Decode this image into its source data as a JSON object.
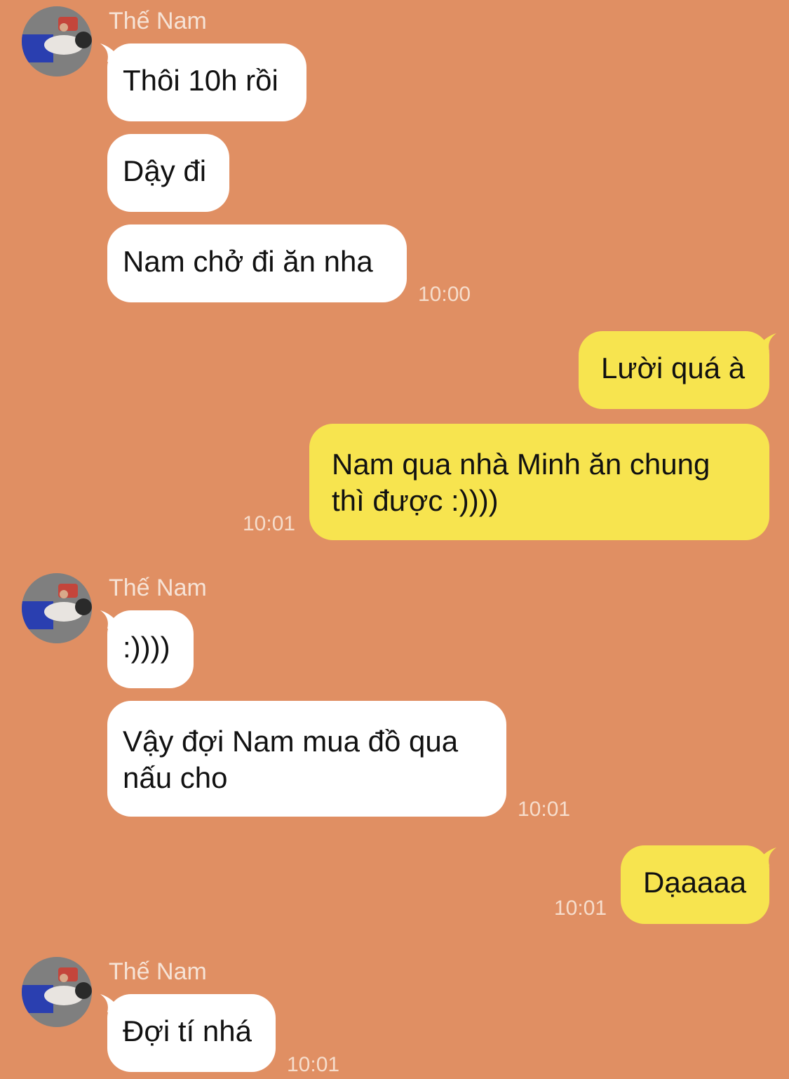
{
  "chat": {
    "contact_name": "Thế Nam",
    "messages": {
      "m1": {
        "text": "Thôi 10h rồi",
        "from": "Thế Nam"
      },
      "m2": {
        "text": "Dậy đi",
        "from": "Thế Nam"
      },
      "m3": {
        "text": "Nam chở đi ăn nha",
        "from": "Thế Nam",
        "time": "10:00"
      },
      "m4": {
        "text": "Lười quá à",
        "from": "me"
      },
      "m5": {
        "line1": "Nam qua nhà Minh ăn chung",
        "line2": "thì được :))))",
        "from": "me",
        "time": "10:01"
      },
      "m6": {
        "text": ":))))",
        "from": "Thế Nam"
      },
      "m7": {
        "line1": "Vậy đợi Nam mua đồ qua",
        "line2": "nấu cho",
        "from": "Thế Nam",
        "time": "10:01"
      },
      "m8": {
        "text": "Dạaaaa",
        "from": "me",
        "time": "10:01"
      },
      "m9": {
        "text": "Đợi tí nhá",
        "from": "Thế Nam",
        "time": "10:01"
      }
    }
  },
  "colors": {
    "background": "#e08f63",
    "incoming_bubble": "#ffffff",
    "outgoing_bubble": "#f7e44f",
    "timestamp_text": "#f6ddcc",
    "sender_name_text": "#f6e3d6"
  },
  "icons": {
    "avatar": "contact-avatar-photo"
  }
}
